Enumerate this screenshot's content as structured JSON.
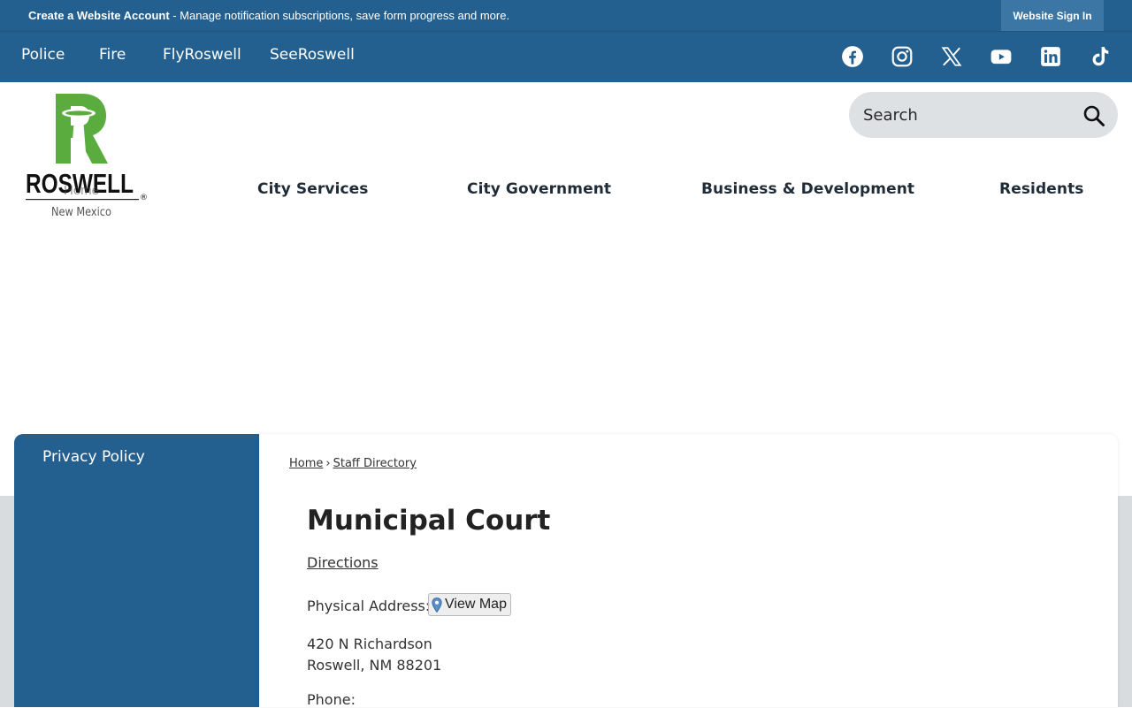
{
  "account_bar": {
    "cta_bold": "Create a Website Account",
    "cta_rest": " - Manage notification subscriptions, save form progress and more.",
    "sign_in": "Website Sign In"
  },
  "utility_nav": [
    "Police",
    "Fire",
    "FlyRoswell",
    "SeeRoswell"
  ],
  "social_icons": [
    "facebook-icon",
    "instagram-icon",
    "x-icon",
    "youtube-icon",
    "linkedin-icon",
    "tiktok-icon"
  ],
  "logo": {
    "wordmark": "ROSWELL",
    "subtitle": "New Mexico",
    "overlay_text": "Home",
    "brand_green": "#5aac3e"
  },
  "search": {
    "placeholder": "Search"
  },
  "main_nav": [
    "City Services",
    "City Government",
    "Business & Development",
    "Residents"
  ],
  "sidebar": {
    "items": [
      "Privacy Policy"
    ]
  },
  "breadcrumb": {
    "home": "Home",
    "separator": "›",
    "current": "Staff Directory"
  },
  "page": {
    "title": "Municipal Court",
    "directions": "Directions",
    "address_label": "Physical Address:",
    "view_map": "View Map",
    "address_line1": "420 N Richardson",
    "address_line2": "Roswell, NM 88201",
    "phone_label": "Phone:"
  },
  "colors": {
    "primary_blue": "#235f8f",
    "signin_blue": "#3b76a4",
    "page_gray": "#d9dcde"
  }
}
